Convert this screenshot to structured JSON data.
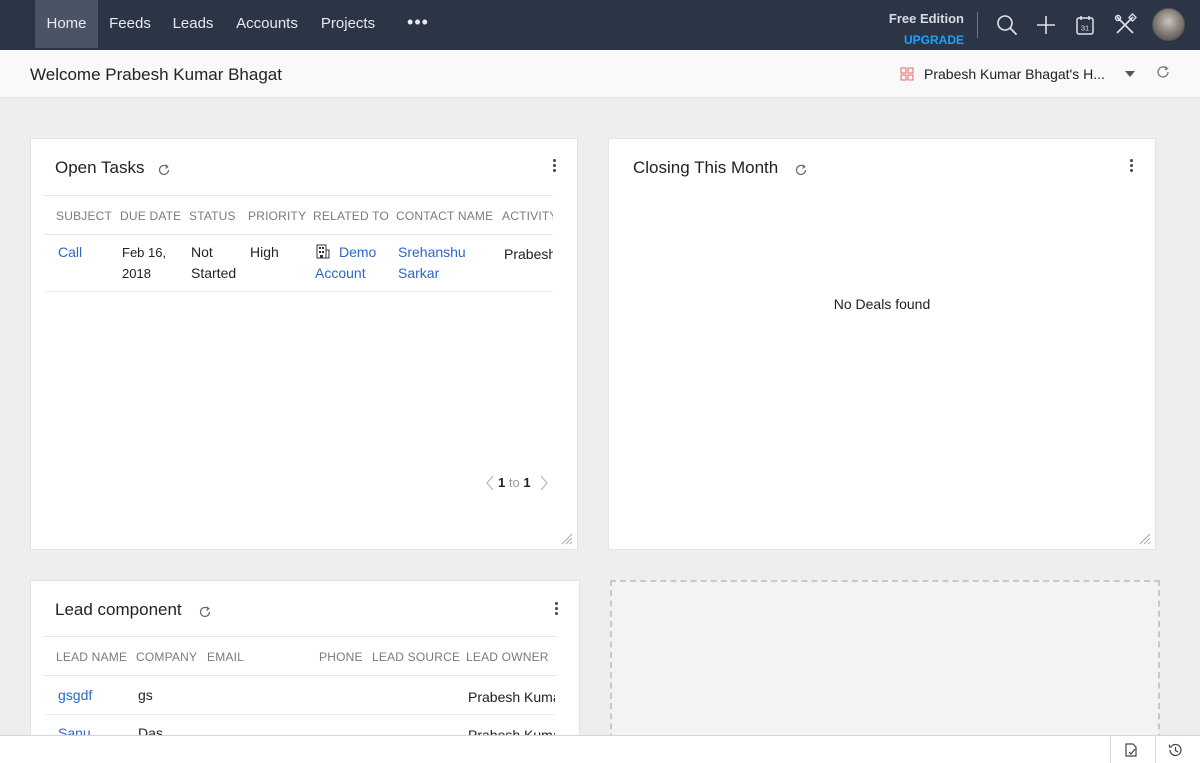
{
  "nav": {
    "tabs": [
      "Home",
      "Feeds",
      "Leads",
      "Accounts",
      "Projects"
    ],
    "more": "•••",
    "edition": "Free Edition",
    "upgrade": "UPGRADE",
    "icons": [
      "search-icon",
      "plus-icon",
      "calendar-icon",
      "setup-tools-icon"
    ],
    "calendar_day": "31"
  },
  "welcome": {
    "title": "Welcome Prabesh Kumar Bhagat",
    "dashboard_name": "Prabesh Kumar Bhagat's H..."
  },
  "open_tasks": {
    "title": "Open Tasks",
    "columns": [
      "SUBJECT",
      "DUE DATE",
      "STATUS",
      "PRIORITY",
      "RELATED TO",
      "CONTACT NAME",
      "ACTIVITY"
    ],
    "rows": [
      {
        "subject": "Call",
        "due_date_line1": "Feb 16,",
        "due_date_line2": "2018",
        "status_line1": "Not",
        "status_line2": "Started",
        "priority": "High",
        "related_line1": "Demo",
        "related_line2": "Account",
        "contact_line1": "Srehanshu",
        "contact_line2": "Sarkar",
        "activity_owner": "Prabesh"
      }
    ],
    "pager": {
      "from": "1",
      "sep": "to",
      "to": "1"
    }
  },
  "closing_month": {
    "title": "Closing This Month",
    "empty": "No Deals found"
  },
  "lead_component": {
    "title": "Lead component",
    "columns": [
      "LEAD NAME",
      "COMPANY",
      "EMAIL",
      "PHONE",
      "LEAD SOURCE",
      "LEAD OWNER"
    ],
    "rows": [
      {
        "lead_name": "gsgdf",
        "company": "gs",
        "email": "",
        "phone": "",
        "source": "",
        "owner": "Prabesh Kuma"
      },
      {
        "lead_name": "Sanu",
        "company": "Das",
        "email": "",
        "phone": "",
        "source": "",
        "owner": "Prabesh Kuma"
      }
    ]
  },
  "colors": {
    "nav_bg": "#2c3546",
    "nav_active": "#4b5466",
    "link": "#2c67c7",
    "upgrade": "#1fa1ff"
  }
}
